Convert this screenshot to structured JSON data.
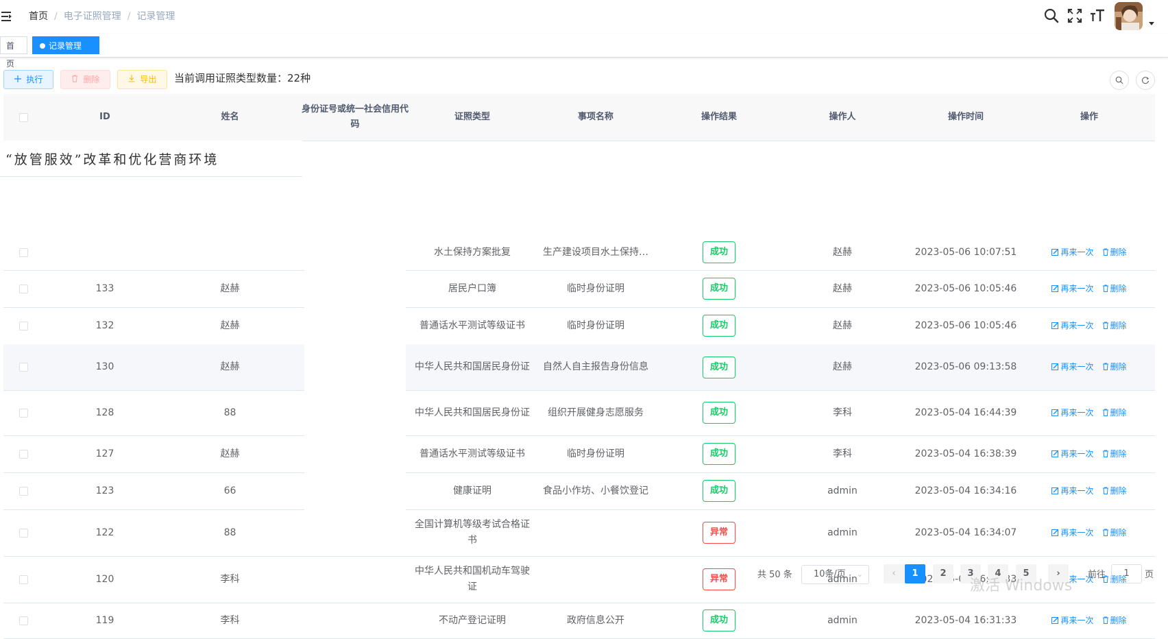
{
  "breadcrumb": {
    "home": "首页",
    "sep": "/",
    "level1": "电子证照管理",
    "level2": "记录管理"
  },
  "tags": {
    "home": "首页",
    "active": "记录管理",
    "close": "×"
  },
  "toolbar": {
    "exec_label": "执行",
    "delete_label": "删除",
    "export_label": "导出",
    "count_text": "当前调用证照类型数量：22种"
  },
  "table": {
    "headers": {
      "id": "ID",
      "name": "姓名",
      "idcard": "身份证号或统一社会信用代码",
      "cert_type": "证照类型",
      "item_name": "事项名称",
      "result": "操作结果",
      "operator": "操作人",
      "time": "操作时间",
      "actions": "操作"
    },
    "overlay_text": "“放管服效”改革和优化营商环境",
    "retry_label": "再来一次",
    "delete_label": "删除",
    "rows": [
      {
        "id": "",
        "name": "",
        "cert_type": "水土保持方案批复",
        "item_name": "生产建设项目水土保持…",
        "result": "成功",
        "operator": "赵赫",
        "time": "2023-05-06 10:07:51"
      },
      {
        "id": "133",
        "name": "赵赫",
        "cert_type": "居民户口簿",
        "item_name": "临时身份证明",
        "result": "成功",
        "operator": "赵赫",
        "time": "2023-05-06 10:05:46"
      },
      {
        "id": "132",
        "name": "赵赫",
        "cert_type": "普通话水平测试等级证书",
        "item_name": "临时身份证明",
        "result": "成功",
        "operator": "赵赫",
        "time": "2023-05-06 10:05:46"
      },
      {
        "id": "130",
        "name": "赵赫",
        "cert_type": "中华人民共和国居民身份证",
        "item_name": "自然人自主报告身份信息",
        "result": "成功",
        "operator": "赵赫",
        "time": "2023-05-06 09:13:58"
      },
      {
        "id": "128",
        "name": "88",
        "cert_type": "中华人民共和国居民身份证",
        "item_name": "组织开展健身志愿服务",
        "result": "成功",
        "operator": "李科",
        "time": "2023-05-04 16:44:39"
      },
      {
        "id": "127",
        "name": "赵赫",
        "cert_type": "普通话水平测试等级证书",
        "item_name": "临时身份证明",
        "result": "成功",
        "operator": "李科",
        "time": "2023-05-04 16:38:39"
      },
      {
        "id": "123",
        "name": "66",
        "cert_type": "健康证明",
        "item_name": "食品小作坊、小餐饮登记",
        "result": "成功",
        "operator": "admin",
        "time": "2023-05-04 16:34:16"
      },
      {
        "id": "122",
        "name": "88",
        "cert_type": "全国计算机等级考试合格证书",
        "item_name": "",
        "result": "异常",
        "operator": "admin",
        "time": "2023-05-04 16:34:07"
      },
      {
        "id": "120",
        "name": "李科",
        "cert_type": "中华人民共和国机动车驾驶证",
        "item_name": "",
        "result": "异常",
        "operator": "admin",
        "time": "2023-05-04 16:31:33"
      },
      {
        "id": "119",
        "name": "李科",
        "cert_type": "不动产登记证明",
        "item_name": "政府信息公开",
        "result": "成功",
        "operator": "admin",
        "time": "2023-05-04 16:31:33"
      }
    ]
  },
  "pagination": {
    "total_text": "共 50 条",
    "page_size": "10条/页",
    "pages": [
      "1",
      "2",
      "3",
      "4",
      "5"
    ],
    "current": "1",
    "prev": "‹",
    "next": "›",
    "goto_label": "前往",
    "goto_value": "1",
    "page_suffix": "页"
  },
  "watermark": "激活 Windows",
  "colors": {
    "primary": "#1890ff",
    "success": "#13ce66",
    "danger": "#ff4949",
    "warning": "#ffba00"
  },
  "icons": {
    "hamburger": "hamburger-icon",
    "search": "search-icon",
    "fullscreen": "fullscreen-icon",
    "font_size": "font-size-icon",
    "avatar": "avatar",
    "caret": "caret-down-icon",
    "plus": "plus-icon",
    "trash": "trash-icon",
    "download": "download-icon",
    "refresh": "refresh-icon",
    "edit": "edit-icon"
  }
}
